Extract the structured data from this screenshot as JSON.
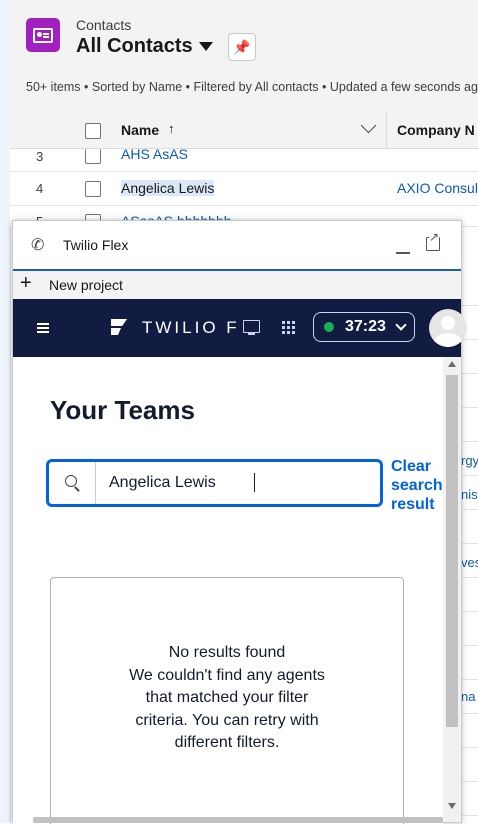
{
  "list_header": {
    "object_label": "Contacts",
    "list_name": "All Contacts",
    "meta": "50+ items • Sorted by Name • Filtered by All contacts • Updated a few seconds ago"
  },
  "table": {
    "columns": [
      "Name",
      "Company N"
    ],
    "sort_arrow": "↑",
    "rows": [
      {
        "num": "3",
        "name": "AHS AsAS",
        "company": ""
      },
      {
        "num": "4",
        "name": "Angelica Lewis",
        "company": "AXIO Consul"
      },
      {
        "num": "5",
        "name": "ASasAS hhhhhhh",
        "company": ""
      }
    ],
    "side_fragments": [
      "rgy",
      "nist",
      "ves",
      "na"
    ]
  },
  "twilio_panel": {
    "title": "Twilio Flex",
    "new_project_label": "New project",
    "brand": "TWILIO FLEX",
    "status_timer": "37:23",
    "status_color": "#14b053",
    "page_title": "Your Teams",
    "search": {
      "value": "Angelica Lewis",
      "clear_label": "Clear search result"
    },
    "empty_state": {
      "line1": "No results found",
      "line2": "We couldn't find any agents that matched your filter criteria. You can retry with different filters."
    }
  }
}
